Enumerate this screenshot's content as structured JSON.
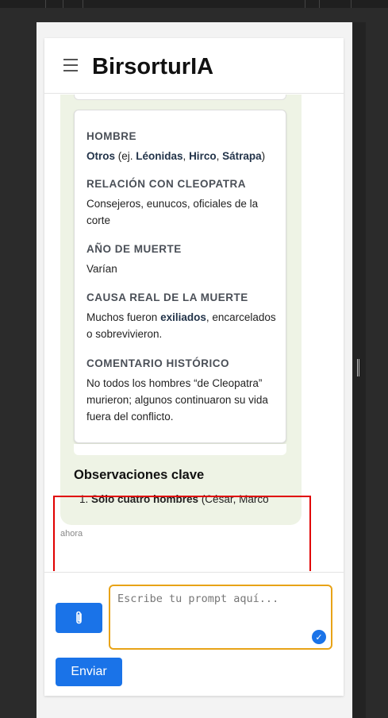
{
  "app": {
    "title": "BirsorturIA"
  },
  "entry": {
    "fields": [
      {
        "label": "HOMBRE",
        "value_html": "<b>Otros</b> (ej. <b>Léonidas</b>, <b>Hirco</b>, <b>Sátrapa</b>)"
      },
      {
        "label": "RELACIÓN CON CLEOPATRA",
        "value": "Consejeros, eunucos, oficiales de la corte"
      },
      {
        "label": "AÑO DE MUERTE",
        "value": "Varían"
      },
      {
        "label": "CAUSA REAL DE LA MUERTE",
        "value_html": "Muchos fueron <b>exiliados</b>, encarcelados o sobrevivieron."
      },
      {
        "label": "COMENTARIO HISTÓRICO",
        "value": "No todos los hombres “de Cleopatra” murieron; algunos continuaron su vida fuera del conflicto."
      }
    ]
  },
  "observations": {
    "title": "Observaciones clave",
    "item_number": "1.",
    "item_bold": "Sólo cuatro hombres",
    "item_rest": " (César, Marco"
  },
  "message": {
    "timestamp": "ahora"
  },
  "composer": {
    "placeholder": "Escribe tu prompt aquí...",
    "send_label": "Enviar",
    "attach_icon": "paperclip-icon",
    "accent_color": "#1a73e8",
    "focus_color": "#e8a317"
  }
}
